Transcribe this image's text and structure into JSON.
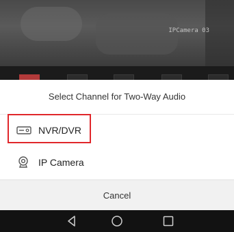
{
  "video": {
    "osd_text": "IPCamera 03"
  },
  "sheet": {
    "title": "Select Channel for Two-Way Audio",
    "options": [
      {
        "label": "NVR/DVR",
        "icon": "nvr-icon",
        "selected": true
      },
      {
        "label": "IP Camera",
        "icon": "camera-icon",
        "selected": false
      }
    ],
    "cancel_label": "Cancel"
  },
  "navbar": {
    "icons": [
      "back-icon",
      "home-icon",
      "recents-icon"
    ]
  },
  "colors": {
    "highlight": "#e0262a",
    "cancel_bg": "#f1f1f1",
    "navbar_bg": "#121212"
  }
}
